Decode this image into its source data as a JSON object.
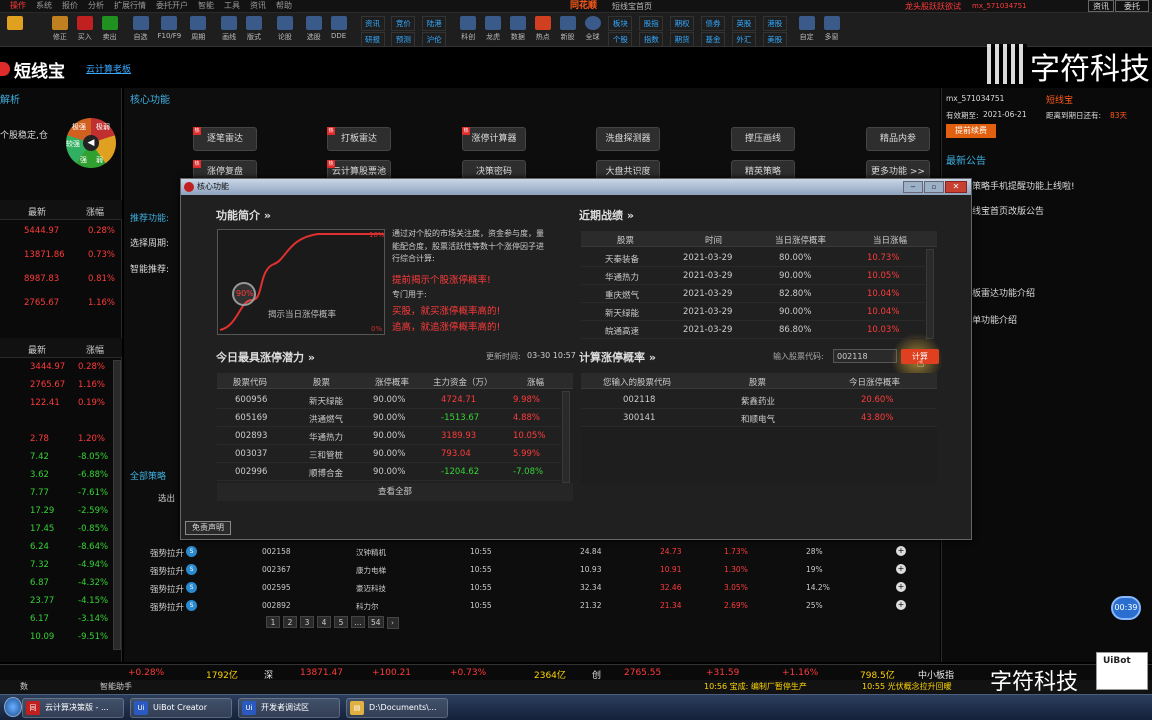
{
  "menubar": [
    "操作",
    "系统",
    "报价",
    "分析",
    "扩展行情",
    "委托开户",
    "智能",
    "工具",
    "资讯",
    "帮助"
  ],
  "app_name": "同花顺",
  "window_caption": "短线宝首页",
  "topright": {
    "title": "龙头股跃跃欲试",
    "user": "mx_571034751",
    "btn1": "资讯",
    "btn2": "委托"
  },
  "toolbar": [
    "修正",
    "买入",
    "卖出",
    "自选",
    "F10/F9",
    "周期",
    "画线",
    "版式",
    "论股",
    "选股",
    "DDE"
  ],
  "toolbar_groups": [
    [
      "资讯",
      "研报"
    ],
    [
      "竞价",
      "预测"
    ],
    [
      "陆港",
      "沪伦"
    ],
    [
      "板块",
      "个股"
    ],
    [
      "股指",
      "指数"
    ],
    [
      "期权",
      "期货"
    ],
    [
      "债券",
      "基金"
    ],
    [
      "英股",
      "外汇"
    ],
    [
      "港股",
      "美股"
    ]
  ],
  "toolbar2": [
    "科创",
    "龙虎",
    "数据",
    "热点",
    "新股",
    "全球",
    "自定",
    "多窗"
  ],
  "page": {
    "logo": "短线宝",
    "cloud_link": "云计算老板",
    "left_section": "解析",
    "left_note": "个股稳定,仓",
    "core_title": "核心功能",
    "recommend": "推荐功能:",
    "period": "选择周期:",
    "smart": "智能推荐:",
    "all_strategy": "全部策略",
    "pick": "选出"
  },
  "gauge": [
    "极强",
    "极弱",
    "较强",
    "强",
    "弱"
  ],
  "func_buttons": [
    "逐笔雷达",
    "打板雷达",
    "涨停计算器",
    "洗盘探测器",
    "撑压画线",
    "精品内参",
    "涨停复盘",
    "云计算股票池",
    "决策密码",
    "大盘共识度",
    "精英策略",
    "更多功能 >>"
  ],
  "left_table1": {
    "h1": "最新",
    "h2": "涨幅",
    "rows": [
      [
        "5444.97",
        "0.28%"
      ],
      [
        "13871.86",
        "0.73%"
      ],
      [
        "8987.83",
        "0.81%"
      ],
      [
        "2765.67",
        "1.16%"
      ]
    ]
  },
  "left_table2": {
    "h1": "最新",
    "h2": "涨幅",
    "rows": [
      [
        "3444.97",
        "0.28%"
      ],
      [
        "2765.67",
        "1.16%"
      ],
      [
        "122.41",
        "0.19%"
      ],
      [
        "2.78",
        "1.20%"
      ],
      [
        "7.42",
        "-8.05%"
      ],
      [
        "3.62",
        "-6.88%"
      ],
      [
        "7.77",
        "-7.61%"
      ],
      [
        "17.29",
        "-2.59%"
      ],
      [
        "17.45",
        "-0.85%"
      ],
      [
        "6.24",
        "-8.64%"
      ],
      [
        "7.32",
        "-4.94%"
      ],
      [
        "6.87",
        "-4.32%"
      ],
      [
        "23.77",
        "-4.15%"
      ],
      [
        "6.17",
        "-3.14%"
      ],
      [
        "10.09",
        "-9.51%"
      ]
    ]
  },
  "right_panel": {
    "user": "mx_571034751",
    "product": "短线宝",
    "expiry_label": "有效期至:",
    "expiry": "2021-06-21",
    "remain": "距离到期日还有:",
    "days": "83天",
    "renew": "提前续费",
    "notice_title": "最新公告",
    "notices": [
      "策略手机提醒功能上线啦!",
      "线宝首页改版公告",
      "板雷达功能介绍",
      "单功能介绍"
    ]
  },
  "watermark": "字符科技",
  "modal": {
    "title": "核心功能",
    "intro_title": "功能简介 »",
    "chart_caption": "揭示当日涨停概率",
    "pct_label": "90%",
    "y_top": "10%",
    "y_bot": "0%",
    "desc": "通过对个股的市场关注度，资金参与度，量能配合度，股票活跃性等数十个涨停因子进行综合计算:",
    "red1": "提前揭示个股涨停概率!",
    "usage": "专门用于:",
    "red2": "买股，就买涨停概率高的!",
    "red3": "追高，就追涨停概率高的!",
    "record_title": "近期战绩 »",
    "record_head": [
      "股票",
      "时间",
      "当日涨停概率",
      "当日涨幅"
    ],
    "records": [
      [
        "天秦装备",
        "2021-03-29",
        "80.00%",
        "10.73%"
      ],
      [
        "华通热力",
        "2021-03-29",
        "90.00%",
        "10.05%"
      ],
      [
        "重庆燃气",
        "2021-03-29",
        "82.80%",
        "10.04%"
      ],
      [
        "新天绿能",
        "2021-03-29",
        "90.00%",
        "10.04%"
      ],
      [
        "皖通高速",
        "2021-03-29",
        "86.80%",
        "10.03%"
      ]
    ],
    "potential_title": "今日最具涨停潜力 »",
    "update_label": "更新时间:",
    "update_time": "03-30 10:57",
    "potential_head": [
      "股票代码",
      "股票",
      "涨停概率",
      "主力资金（万）",
      "涨幅"
    ],
    "potential": [
      [
        "600956",
        "新天绿能",
        "90.00%",
        "4724.71",
        "9.98%"
      ],
      [
        "605169",
        "洪通燃气",
        "90.00%",
        "-1513.67",
        "4.88%"
      ],
      [
        "002893",
        "华通热力",
        "90.00%",
        "3189.93",
        "10.05%"
      ],
      [
        "003037",
        "三和管桩",
        "90.00%",
        "793.04",
        "5.99%"
      ],
      [
        "002996",
        "顺博合金",
        "90.00%",
        "-1204.62",
        "-7.08%"
      ]
    ],
    "view_all": "查看全部",
    "calc_title": "计算涨停概率 »",
    "input_label": "输入股票代码:",
    "input_value": "002118",
    "calc_btn": "计算",
    "calc_head": [
      "您输入的股票代码",
      "股票",
      "今日涨停概率"
    ],
    "calc_rows": [
      [
        "002118",
        "紫鑫药业",
        "20.60%"
      ],
      [
        "300141",
        "和顺电气",
        "43.80%"
      ]
    ],
    "disclaimer": "免责声明"
  },
  "strategy_rows": [
    [
      "强势拉升",
      "002158",
      "汉钟精机",
      "10:55",
      "24.84",
      "24.73",
      "1.73%",
      "28%"
    ],
    [
      "强势拉升",
      "002367",
      "康力电梯",
      "10:55",
      "10.93",
      "10.91",
      "1.30%",
      "19%"
    ],
    [
      "强势拉升",
      "002595",
      "豪迈科技",
      "10:55",
      "32.34",
      "32.46",
      "3.05%",
      "14.2%"
    ],
    [
      "强势拉升",
      "002892",
      "科力尔",
      "10:55",
      "21.32",
      "21.34",
      "2.69%",
      "25%"
    ]
  ],
  "pager": [
    "1",
    "2",
    "3",
    "4",
    "5",
    "...",
    "54"
  ],
  "timer": "00:39",
  "ticker": [
    "+0.28%",
    "1792亿",
    "深",
    "13871.47",
    "+100.21",
    "+0.73%",
    "2364亿",
    "创",
    "2765.55",
    "+31.59",
    "+1.16%",
    "798.5亿",
    "中小板指"
  ],
  "news": [
    "10:56 宝成: 编制厂暂停生产",
    "10:55 光伏概念拉升回暖"
  ],
  "status": [
    "数",
    "智能助手"
  ],
  "uibot": "UiBot",
  "taskbar": [
    "云计算决策版 - ...",
    "UiBot Creator",
    "开发者调试区",
    "D:\\Documents\\..."
  ]
}
